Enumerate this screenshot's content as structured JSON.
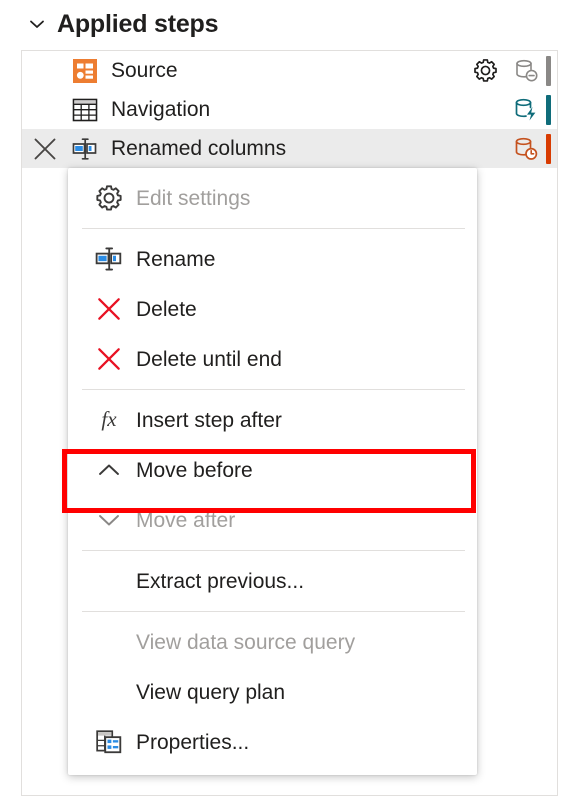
{
  "header": {
    "title": "Applied steps",
    "chevron_icon": "chevron-down-icon",
    "expanded": true
  },
  "colors": {
    "highlight_box": "#ff0000",
    "source_icon_orange": "#ed7d31",
    "db_gray": "#8a8886",
    "db_teal": "#0f6c7a",
    "db_orange": "#c5521f",
    "rename_blue": "#2b8ce4",
    "delete_red": "#e81123",
    "selected_row_bg": "#ebebeb",
    "disabled_text": "#a19f9d",
    "text": "#201f1e"
  },
  "steps": [
    {
      "label": "Source",
      "icon": "source-table-icon",
      "selected": false,
      "has_close": false,
      "has_gear": true,
      "gear_icon": "gear-icon",
      "status_icon": "database-minus-icon",
      "status_color": "#8a8886",
      "bar_color": "#8a8886"
    },
    {
      "label": "Navigation",
      "icon": "table-grid-icon",
      "selected": false,
      "has_close": false,
      "has_gear": false,
      "gear_icon": "",
      "status_icon": "database-lightning-icon",
      "status_color": "#0f6c7a",
      "bar_color": "#0f6c7a"
    },
    {
      "label": "Renamed columns",
      "icon": "rename-columns-icon",
      "selected": true,
      "has_close": true,
      "close_icon": "close-icon",
      "has_gear": false,
      "gear_icon": "",
      "status_icon": "database-clock-icon",
      "status_color": "#c5521f",
      "bar_color": "#d83b01"
    }
  ],
  "context_menu": {
    "items": [
      {
        "label": "Edit settings",
        "icon": "gear-icon",
        "disabled": true,
        "highlighted": false,
        "sep_after": true
      },
      {
        "label": "Rename",
        "icon": "rename-icon",
        "disabled": false,
        "highlighted": false,
        "sep_after": false
      },
      {
        "label": "Delete",
        "icon": "delete-x-icon",
        "disabled": false,
        "highlighted": false,
        "sep_after": false
      },
      {
        "label": "Delete until end",
        "icon": "delete-x-icon",
        "disabled": false,
        "highlighted": false,
        "sep_after": true
      },
      {
        "label": "Insert step after",
        "icon": "fx-icon",
        "disabled": false,
        "highlighted": false,
        "sep_after": false
      },
      {
        "label": "Move before",
        "icon": "chevron-up-icon",
        "disabled": false,
        "highlighted": true,
        "sep_after": false
      },
      {
        "label": "Move after",
        "icon": "chevron-down-icon",
        "disabled": true,
        "highlighted": false,
        "sep_after": true
      },
      {
        "label": "Extract previous...",
        "icon": "",
        "disabled": false,
        "highlighted": false,
        "sep_after": true
      },
      {
        "label": "View data source query",
        "icon": "",
        "disabled": true,
        "highlighted": false,
        "sep_after": false
      },
      {
        "label": "View query plan",
        "icon": "",
        "disabled": false,
        "highlighted": false,
        "sep_after": false
      },
      {
        "label": "Properties...",
        "icon": "properties-icon",
        "disabled": false,
        "highlighted": false,
        "sep_after": false
      }
    ]
  }
}
